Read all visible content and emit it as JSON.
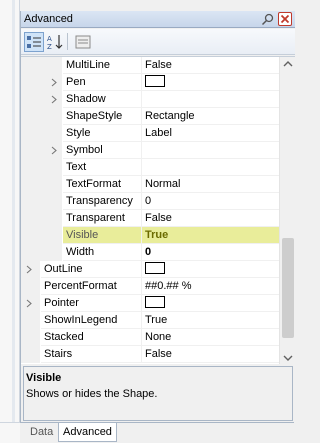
{
  "panel": {
    "title": "Advanced"
  },
  "toolbar": {
    "categorized": "categorized-view",
    "alphabetical": "alphabetical-sort",
    "property_pages": "property-pages"
  },
  "properties": [
    {
      "name": "MultiLine",
      "value": "False",
      "level": 1
    },
    {
      "name": "Pen",
      "value": "",
      "level": 1,
      "expandable": true,
      "swatch": true
    },
    {
      "name": "Shadow",
      "value": "",
      "level": 1,
      "expandable": true
    },
    {
      "name": "ShapeStyle",
      "value": "Rectangle",
      "level": 1
    },
    {
      "name": "Style",
      "value": "Label",
      "level": 1
    },
    {
      "name": "Symbol",
      "value": "",
      "level": 1,
      "expandable": true
    },
    {
      "name": "Text",
      "value": "",
      "level": 1
    },
    {
      "name": "TextFormat",
      "value": "Normal",
      "level": 1
    },
    {
      "name": "Transparency",
      "value": "0",
      "level": 1
    },
    {
      "name": "Transparent",
      "value": "False",
      "level": 1
    },
    {
      "name": "Visible",
      "value": "True",
      "level": 1,
      "selected": true
    },
    {
      "name": "Width",
      "value": "0",
      "level": 1,
      "bold_value": true
    },
    {
      "name": "OutLine",
      "value": "",
      "level": 0,
      "expandable": true,
      "swatch": true
    },
    {
      "name": "PercentFormat",
      "value": "##0.## %",
      "level": 0
    },
    {
      "name": "Pointer",
      "value": "",
      "level": 0,
      "expandable": true,
      "swatch": true
    },
    {
      "name": "ShowInLegend",
      "value": "True",
      "level": 0
    },
    {
      "name": "Stacked",
      "value": "None",
      "level": 0
    },
    {
      "name": "Stairs",
      "value": "False",
      "level": 0
    }
  ],
  "description": {
    "title": "Visible",
    "text": "Shows or hides the Shape."
  },
  "tabs": [
    {
      "label": "Data",
      "active": false
    },
    {
      "label": "Advanced",
      "active": true
    }
  ],
  "colors": {
    "selected_row": "#e9ed9a",
    "close_button_border": "#c0392b",
    "title_gradient_top": "#dbe6f4"
  }
}
